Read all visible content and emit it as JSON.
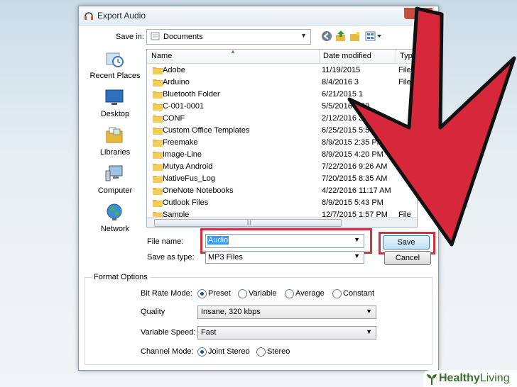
{
  "window": {
    "title": "Export Audio",
    "close": "x"
  },
  "save_in": {
    "label": "Save in:",
    "value": "Documents"
  },
  "places": [
    "Recent Places",
    "Desktop",
    "Libraries",
    "Computer",
    "Network"
  ],
  "columns": {
    "name": "Name",
    "date": "Date modified",
    "type": "Type"
  },
  "files": [
    {
      "name": "Adobe",
      "date": "11/19/2015",
      "type": "File"
    },
    {
      "name": "Arduino",
      "date": "8/4/2016 3",
      "type": "File"
    },
    {
      "name": "Bluetooth Folder",
      "date": "6/21/2015 1",
      "type": ""
    },
    {
      "name": "C-001-0001",
      "date": "5/5/2016 9:59",
      "type": ""
    },
    {
      "name": "CONF",
      "date": "2/12/2016 3:49",
      "type": ""
    },
    {
      "name": "Custom Office Templates",
      "date": "6/25/2015 5:58 P",
      "type": ""
    },
    {
      "name": "Freemake",
      "date": "8/9/2015 2:35 PM",
      "type": ""
    },
    {
      "name": "Image-Line",
      "date": "8/9/2015 4:20 PM",
      "type": ""
    },
    {
      "name": "Mutya Android",
      "date": "7/22/2016 9:26 AM",
      "type": ""
    },
    {
      "name": "NativeFus_Log",
      "date": "7/20/2015 8:35 AM",
      "type": ""
    },
    {
      "name": "OneNote Notebooks",
      "date": "4/22/2016 11:17 AM",
      "type": ""
    },
    {
      "name": "Outlook Files",
      "date": "8/9/2015 5:43 PM",
      "type": ""
    },
    {
      "name": "Sample",
      "date": "12/7/2015 1:57 PM",
      "type": "File"
    }
  ],
  "file_name": {
    "label": "File name:",
    "value": "Audio"
  },
  "save_as_type": {
    "label": "Save as type:",
    "value": "MP3 Files"
  },
  "buttons": {
    "save": "Save",
    "cancel": "Cancel"
  },
  "format_options": {
    "title": "Format Options",
    "bit_rate_mode": {
      "label": "Bit Rate Mode:",
      "options": [
        "Preset",
        "Variable",
        "Average",
        "Constant"
      ],
      "selected": "Preset"
    },
    "quality": {
      "label": "Quality",
      "value": "Insane, 320 kbps"
    },
    "variable_speed": {
      "label": "Variable Speed:",
      "value": "Fast"
    },
    "channel_mode": {
      "label": "Channel Mode:",
      "options": [
        "Joint Stereo",
        "Stereo"
      ],
      "selected": "Joint Stereo"
    }
  },
  "watermark": {
    "brand": "Healthy",
    "brand2": "Living"
  },
  "colors": {
    "highlight_red": "#d32f3c",
    "selection_blue": "#3399ff",
    "folder_yellow": "#e8b93a"
  },
  "icons": [
    "headphones-icon",
    "back-icon",
    "up-folder-icon",
    "new-folder-icon",
    "views-icon",
    "folder-icon",
    "recent-places-icon",
    "desktop-icon",
    "libraries-icon",
    "computer-icon",
    "network-icon",
    "sprout-icon"
  ]
}
